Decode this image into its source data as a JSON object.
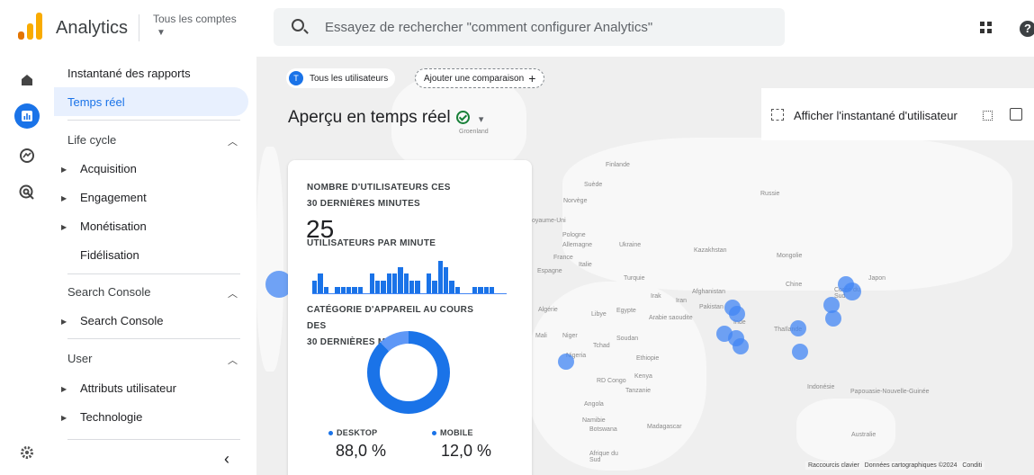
{
  "app": {
    "title": "Analytics",
    "accounts_label": "Tous les comptes"
  },
  "search": {
    "placeholder": "Essayez de rechercher \"comment configurer Analytics\""
  },
  "colors": {
    "accent": "#1a73e8",
    "logo_orange": "#f9ab00",
    "logo_dark_orange": "#e37400",
    "selected_bg": "#e8f0fe"
  },
  "rail": {
    "icons": [
      "home-icon",
      "reports-icon",
      "explore-icon",
      "advertising-icon",
      "settings-icon"
    ]
  },
  "nav": {
    "snapshot": "Instantané des rapports",
    "realtime": "Temps réel",
    "sections": [
      {
        "title": "Life cycle",
        "items": [
          "Acquisition",
          "Engagement",
          "Monétisation",
          "Fidélisation"
        ]
      },
      {
        "title": "Search Console",
        "items": [
          "Search Console"
        ]
      },
      {
        "title": "User",
        "items": [
          "Attributs utilisateur",
          "Technologie"
        ]
      }
    ]
  },
  "toolbar": {
    "all_users_chip": "Tous les utilisateurs",
    "all_users_initial": "T",
    "add_comparison": "Ajouter une comparaison",
    "page_title": "Aperçu en temps réel",
    "snapshot_button": "Afficher l'instantané d'utilisateur"
  },
  "card": {
    "users_heading_1": "NOMBRE D'UTILISATEURS CES",
    "users_heading_2": "30 DERNIÈRES MINUTES",
    "users_count": "25",
    "per_minute_heading": "UTILISATEURS PAR MINUTE",
    "per_minute_values": [
      2,
      3,
      1,
      0,
      1,
      1,
      1,
      1,
      1,
      0,
      3,
      2,
      2,
      3,
      3,
      4,
      3,
      2,
      2,
      0,
      3,
      2,
      5,
      4,
      2,
      1,
      0,
      0,
      1,
      1,
      1,
      1,
      0,
      0
    ],
    "device_heading_1": "CATÉGORIE D'APPAREIL AU COURS DES",
    "device_heading_2": "30 DERNIÈRES MINUTES",
    "devices": [
      {
        "label": "DESKTOP",
        "value": "88,0 %",
        "share": 0.88
      },
      {
        "label": "MOBILE",
        "value": "12,0 %",
        "share": 0.12
      }
    ]
  },
  "map": {
    "labels": [
      "Groenland",
      "Finlande",
      "Suède",
      "Norvège",
      "Russie",
      "oyaume-Uni",
      "Pologne",
      "Allemagne",
      "Ukraine",
      "Kazakhstan",
      "Mongolie",
      "France",
      "Italie",
      "Espagne",
      "Turquie",
      "Chine",
      "Japon",
      "Irak",
      "Iran",
      "Afghanistan",
      "Pakistan",
      "Inde",
      "Algérie",
      "Libye",
      "Egypte",
      "Arabie saoudite",
      "Mali",
      "Niger",
      "Tchad",
      "Soudan",
      "Thaïlande",
      "Nigeria",
      "Ethiopie",
      "Kenya",
      "RD Congo",
      "Tanzanie",
      "Angola",
      "Namibie",
      "Botswana",
      "Madagascar",
      "Indonésie",
      "Papouasie-Nouvelle-Guinée",
      "Australie",
      "Afrique du Sud",
      "Corée du Sud"
    ],
    "footer": [
      "Raccourcis clavier",
      "Données cartographiques ©2024",
      "Conditi"
    ]
  }
}
